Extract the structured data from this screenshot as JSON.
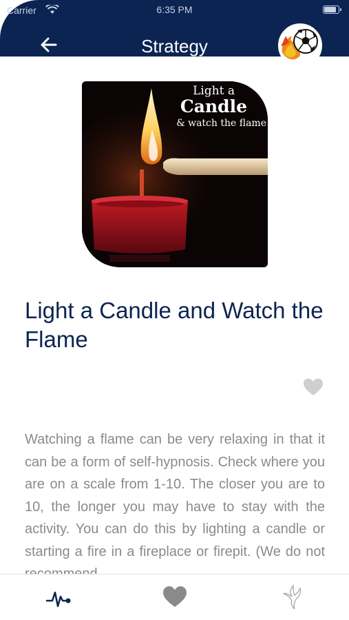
{
  "status_bar": {
    "carrier": "Carrier",
    "time": "6:35 PM"
  },
  "header": {
    "title": "Strategy",
    "back_icon": "arrow-left-icon",
    "avatar_icon": "flaming-soccer-ball-icon",
    "background_color": "#0c2452"
  },
  "hero_image": {
    "line1": "Light a",
    "line2": "Candle",
    "line3": "& watch the flame"
  },
  "strategy": {
    "title": "Light a Candle and Watch the Flame",
    "favorite_icon": "heart-icon",
    "description": "Watching a flame can be very relaxing in that it can be a form of self-hypnosis. Check where you are on a scale from 1-10. The closer you are to 10, the longer you may have to stay with the activity. You can do this by lighting a candle or starting a fire in a fireplace or firepit. (We do not recommend"
  },
  "tab_bar": {
    "tabs": [
      {
        "icon": "heartbeat-pulse-icon",
        "color": "#0c2452"
      },
      {
        "icon": "heart-icon",
        "color": "#8a8a8a"
      },
      {
        "icon": "phoenix-bird-icon",
        "color": "#8a8a8a"
      }
    ]
  },
  "colors": {
    "accent": "#0c2452",
    "body_text": "#8a8a8a",
    "inactive_icon": "#c6c6c6"
  }
}
